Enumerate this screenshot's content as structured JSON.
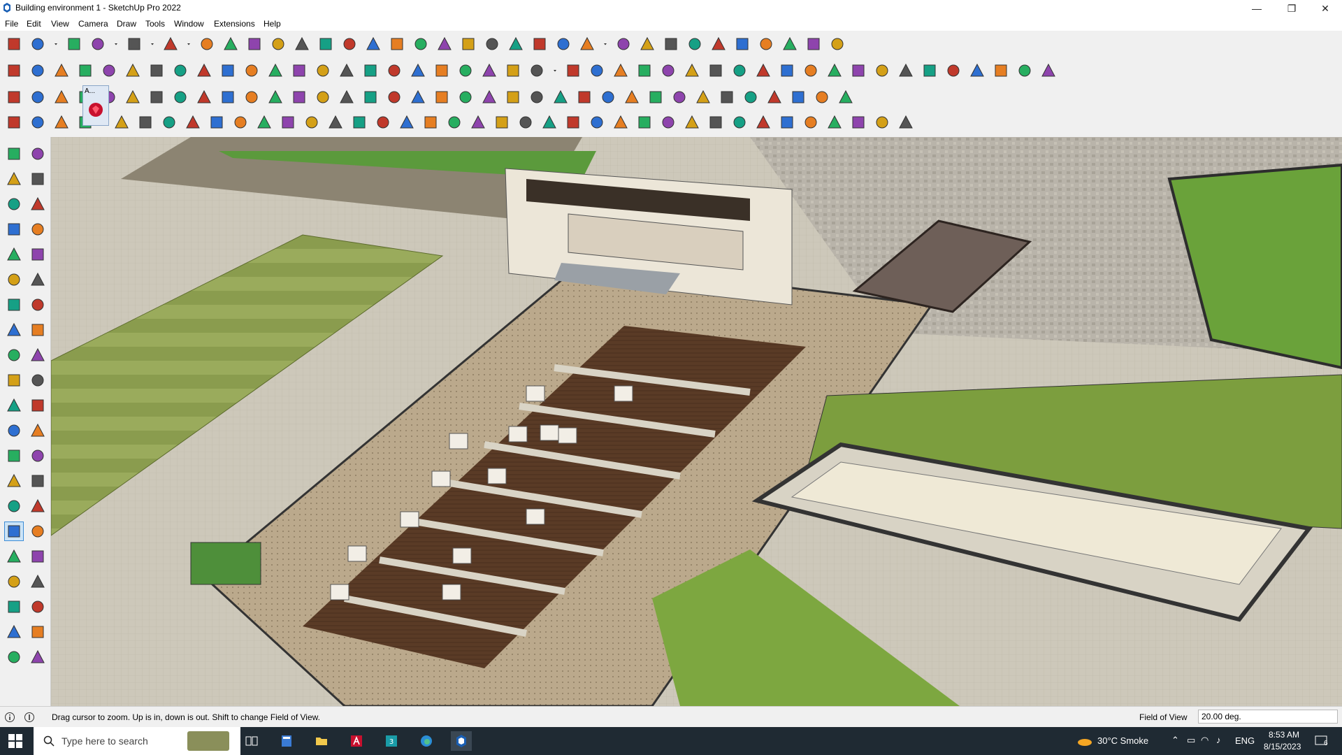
{
  "window": {
    "title": "Building environment 1 - SketchUp Pro 2022",
    "minimize_glyph": "—",
    "maximize_glyph": "❐",
    "close_glyph": "✕"
  },
  "menu": [
    "File",
    "Edit",
    "View",
    "Camera",
    "Draw",
    "Tools",
    "Window",
    "Extensions",
    "Help"
  ],
  "toolbar": {
    "row1_icons": [
      "search-icon",
      "select-icon",
      "dropdown-icon",
      "eraser-icon",
      "line-tool-icon",
      "dropdown-icon",
      "arc-tool-icon",
      "dropdown-icon",
      "shape-tool-icon",
      "dropdown-icon",
      "push-pull-icon",
      "follow-me-icon",
      "move-icon",
      "rotate-icon",
      "scale-icon",
      "tape-measure-icon",
      "text-icon",
      "paint-bucket-icon",
      "orbit-icon",
      "pan-icon",
      "zoom-icon",
      "zoom-extents-icon",
      "iso-view-icon",
      "top-view-icon",
      "front-view-icon",
      "section-icon",
      "user-icon",
      "dropdown-icon",
      "add-location-icon",
      "photo-texture-icon",
      "geo-location-icon",
      "import-icon",
      "export-icon",
      "extension-icon",
      "sandbox-icon",
      "undo-icon",
      "redo-icon",
      "hand-icon"
    ],
    "row2_icons": [
      "component-icon",
      "material-icon",
      "style-icon",
      "push-pull-plugin-icon",
      "arrow-down-icon",
      "arrow-rotate-icon",
      "arrow-x-icon",
      "arrow-y-icon",
      "arrow-n-icon",
      "arrow-z-icon",
      "arrow-f-icon",
      "curve-icon",
      "face-blue-icon",
      "face-red-icon",
      "face-purple-icon",
      "geometry-green-icon",
      "solid-tool-icon",
      "house-icon",
      "house-outline-icon",
      "warehouse-icon",
      "home-icon",
      "garage-icon",
      "fe-plugin-icon",
      "dropdown-icon",
      "label-tag-icon",
      "pencil-red-icon",
      "rectangle-icon",
      "circle-icon",
      "polygon-icon",
      "ellipse-icon",
      "parallelogram-icon",
      "freehand-icon",
      "spiral-icon",
      "rope-icon",
      "curve-blue-icon",
      "loop-icon",
      "scale-red-icon",
      "eraser-pink-icon",
      "brick-icon",
      "roof-icon",
      "stairs-icon",
      "terrain-icon",
      "cloud-icon",
      "window-icon",
      "door-icon"
    ],
    "row3_icons": [
      "face-blue-icon",
      "face-blue2-icon",
      "plane-yellow-icon",
      "pin-icon",
      "red-plane-icon",
      "layers-icon",
      "rotate-orange-icon",
      "red-box-icon",
      "grid-red-icon",
      "frame-icon",
      "box-brown-icon",
      "link-icon",
      "curve-orange-icon",
      "plus-red-icon",
      "plus-green-icon",
      "x-blue-icon",
      "cone-icon",
      "pyramid-icon",
      "warning-icon",
      "loop-orange-icon",
      "bezier-icon",
      "hook-icon",
      "arrow-blue-icon",
      "arrow-red-icon",
      "gear-green-icon",
      "plugin-red-icon",
      "plugin-box-icon",
      "cube-red-icon",
      "grid-icon",
      "table-icon",
      "grid-orange-icon",
      "grid-yellow-icon",
      "grid-yellow2-icon",
      "x-small-icon",
      "arc-dotted-icon",
      "grid-outline-icon"
    ],
    "row4_icons": [
      "polyline-icon",
      "bezier-red-icon",
      "weld-icon",
      "ruby-icon",
      "dropdown-icon",
      "tube-icon",
      "rectangle-3d-icon",
      "sphere-icon",
      "helix-icon",
      "cut-icon",
      "corner-icon",
      "angle-icon",
      "line-red-icon",
      "arc-orange-icon",
      "gate-icon",
      "triangle-icon",
      "comb-icon",
      "cylinder-icon",
      "wheel-icon",
      "cap-icon",
      "arrow-left-icon",
      "stack-icon",
      "ramp-icon",
      "lines-icon",
      "lines2-icon",
      "lines3-icon",
      "building-icon",
      "stairs2-icon",
      "column-icon",
      "wall-icon",
      "grid-dark-icon",
      "grid-hatch-icon",
      "comb2-icon",
      "comb3-icon",
      "gear-dark-icon",
      "gear2-icon",
      "fence-icon",
      "fence2-icon",
      "prism-icon"
    ],
    "tooltip_badge": "A..."
  },
  "left_tools": [
    "select-icon",
    "orbit-tool-icon",
    "paint-bucket-icon",
    "eraser-icon",
    "component-icon",
    "tape-icon",
    "line-icon",
    "freehand-icon",
    "rectangle-icon",
    "rotated-rectangle-icon",
    "circle-icon",
    "polygon-icon",
    "arc-icon",
    "arc-2pt-icon",
    "pie-icon",
    "arc-3pt-icon",
    "move-icon",
    "push-pull-icon",
    "rotate-icon",
    "follow-me-icon",
    "scale-icon",
    "offset-icon",
    "tape-measure-icon",
    "dimension-icon",
    "protractor-icon",
    "text-icon",
    "axes-icon",
    "3d-text-icon",
    "orbit-icon",
    "pan-icon",
    "zoom-icon",
    "zoom-window-icon",
    "zoom-extents-icon",
    "previous-view-icon",
    "walk-icon",
    "look-around-icon",
    "footprints-icon",
    "position-camera-icon",
    "section-plane-icon",
    "section-display-icon",
    "section-fill-icon",
    "section-cut-icon"
  ],
  "viewport": {
    "sky_color": "#dcd8cd",
    "ground_color": "#cfcabd",
    "grass_color": "#8ea154",
    "deck_color": "#5a3b26",
    "wall_color": "#ece6d8"
  },
  "status": {
    "message": "Drag cursor to zoom.  Up is in, down is out. Shift to change Field of View.",
    "vcb_label": "Field of View",
    "vcb_value": "20.00 deg."
  },
  "taskbar": {
    "search_placeholder": "Type here to search",
    "weather": "30°C  Smoke",
    "language": "ENG",
    "time": "8:53 AM",
    "date": "8/15/2023",
    "notification_count": "6"
  }
}
